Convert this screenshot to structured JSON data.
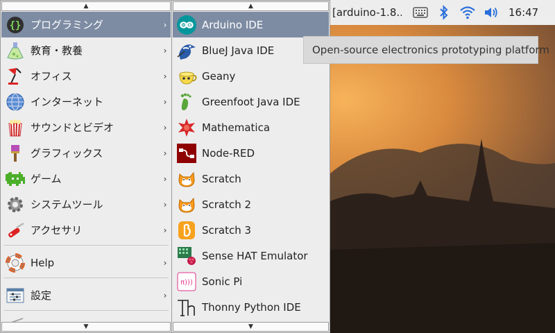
{
  "taskbar": {
    "window_title": "[arduino-1.8...",
    "clock": "16:47",
    "icons": [
      "keyboard-icon",
      "bluetooth-icon",
      "wifi-icon",
      "volume-icon"
    ]
  },
  "main_menu": {
    "items": [
      {
        "label": "プログラミング",
        "icon": "programming-icon"
      },
      {
        "label": "教育・教養",
        "icon": "education-icon"
      },
      {
        "label": "オフィス",
        "icon": "office-icon"
      },
      {
        "label": "インターネット",
        "icon": "internet-icon"
      },
      {
        "label": "サウンドとビデオ",
        "icon": "sound-video-icon"
      },
      {
        "label": "グラフィックス",
        "icon": "graphics-icon"
      },
      {
        "label": "ゲーム",
        "icon": "games-icon"
      },
      {
        "label": "システムツール",
        "icon": "system-tools-icon"
      },
      {
        "label": "アクセサリ",
        "icon": "accessories-icon"
      },
      {
        "label": "Help",
        "icon": "help-icon"
      },
      {
        "label": "設定",
        "icon": "settings-icon"
      }
    ]
  },
  "sub_menu": {
    "items": [
      {
        "label": "Arduino IDE",
        "icon": "arduino-icon"
      },
      {
        "label": "BlueJ Java IDE",
        "icon": "bluej-icon"
      },
      {
        "label": "Geany",
        "icon": "geany-icon"
      },
      {
        "label": "Greenfoot Java IDE",
        "icon": "greenfoot-icon"
      },
      {
        "label": "Mathematica",
        "icon": "mathematica-icon"
      },
      {
        "label": "Node-RED",
        "icon": "node-red-icon"
      },
      {
        "label": "Scratch",
        "icon": "scratch-icon"
      },
      {
        "label": "Scratch 2",
        "icon": "scratch2-icon"
      },
      {
        "label": "Scratch 3",
        "icon": "scratch3-icon"
      },
      {
        "label": "Sense HAT Emulator",
        "icon": "sense-hat-icon"
      },
      {
        "label": "Sonic Pi",
        "icon": "sonic-pi-icon"
      },
      {
        "label": "Thonny Python IDE",
        "icon": "thonny-icon"
      }
    ]
  },
  "tooltip": "Open-source electronics prototyping platform",
  "colors": {
    "highlight": "#7d8ca3",
    "menu_bg": "#ededed",
    "arduino_teal": "#00979c"
  }
}
